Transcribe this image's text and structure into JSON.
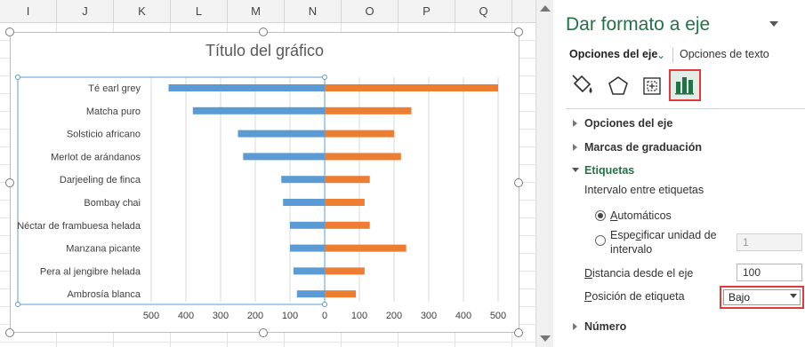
{
  "sheet": {
    "columns": [
      "I",
      "J",
      "K",
      "L",
      "M",
      "N",
      "O",
      "P",
      "Q"
    ]
  },
  "chart": {
    "title": "Título del gráfico"
  },
  "chart_data": {
    "type": "bar",
    "orientation": "horizontal",
    "title": "Título del gráfico",
    "categories": [
      "Té earl grey",
      "Matcha puro",
      "Solsticio africano",
      "Merlot de arándanos",
      "Darjeeling de finca",
      "Bombay chai",
      "Néctar de frambuesa helada",
      "Manzana picante",
      "Pera al jengibre helada",
      "Ambrosía blanca"
    ],
    "series": [
      {
        "values": [
          -450,
          -380,
          -250,
          -235,
          -125,
          -120,
          -100,
          -100,
          -90,
          -80
        ]
      },
      {
        "values": [
          500,
          250,
          200,
          220,
          130,
          115,
          130,
          235,
          115,
          90
        ]
      }
    ],
    "xlim": [
      -500,
      500
    ],
    "xticks": [
      "500",
      "400",
      "300",
      "200",
      "100",
      "0",
      "100",
      "200",
      "300",
      "400",
      "500"
    ],
    "grid": true,
    "colors": [
      "#5b9bd5",
      "#ed7d31"
    ]
  },
  "pane": {
    "title": "Dar formato a eje",
    "tab_axis": "Opciones del eje",
    "tab_text": "Opciones de texto",
    "icons": [
      "fill-line-icon",
      "effects-icon",
      "size-properties-icon",
      "axis-options-icon"
    ],
    "sections": {
      "axis_options": "Opciones del eje",
      "tick_marks": "Marcas de graduación",
      "labels": "Etiquetas",
      "number": "Número"
    },
    "interval_label": "Intervalo entre etiquetas",
    "radio_auto": "Automáticos",
    "radio_specify_1": "Especificar unidad de",
    "radio_specify_2": "intervalo",
    "interval_value": "1",
    "distance_label": "Distancia desde el eje",
    "distance_value": "100",
    "position_label": "Posición de etiqueta",
    "position_value": "Bajo",
    "accent": "#217346",
    "highlight": "#e03a3a"
  }
}
